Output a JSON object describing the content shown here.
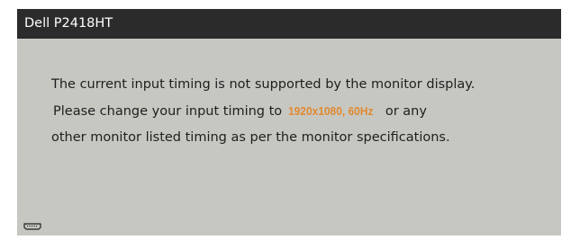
{
  "osd": {
    "title": "Dell P2418HT",
    "message": {
      "line1": "The current input timing is not supported by the monitor display.",
      "line2_prefix": "Please change your input timing to",
      "recommended_timing": "1920x1080, 60Hz",
      "line2_suffix": "or any",
      "line3": "other monitor listed timing as per the monitor specifications."
    },
    "input_icon": "hdmi-connector-icon"
  },
  "colors": {
    "titlebar": "#2b2b2b",
    "body": "#c7c7c2",
    "highlight": "#e08a30",
    "text": "#1e1e1e"
  }
}
